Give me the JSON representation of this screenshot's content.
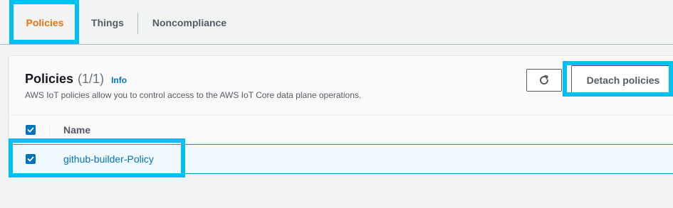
{
  "tabs": [
    {
      "label": "Policies",
      "active": true
    },
    {
      "label": "Things",
      "active": false
    },
    {
      "label": "Noncompliance",
      "active": false
    }
  ],
  "panel": {
    "title": "Policies",
    "count": "(1/1)",
    "info_label": "Info",
    "description": "AWS IoT policies allow you to control access to the AWS IoT Core data plane operations.",
    "refresh_icon": "refresh-icon",
    "detach_label": "Detach policies"
  },
  "table": {
    "columns": [
      "Name"
    ],
    "select_all_checked": true,
    "rows": [
      {
        "name": "github-builder-Policy",
        "checked": true
      }
    ]
  },
  "colors": {
    "accent": "#ec7211",
    "link": "#0073bb",
    "highlight": "#00c0f3",
    "selected_row": "#f1faff"
  }
}
